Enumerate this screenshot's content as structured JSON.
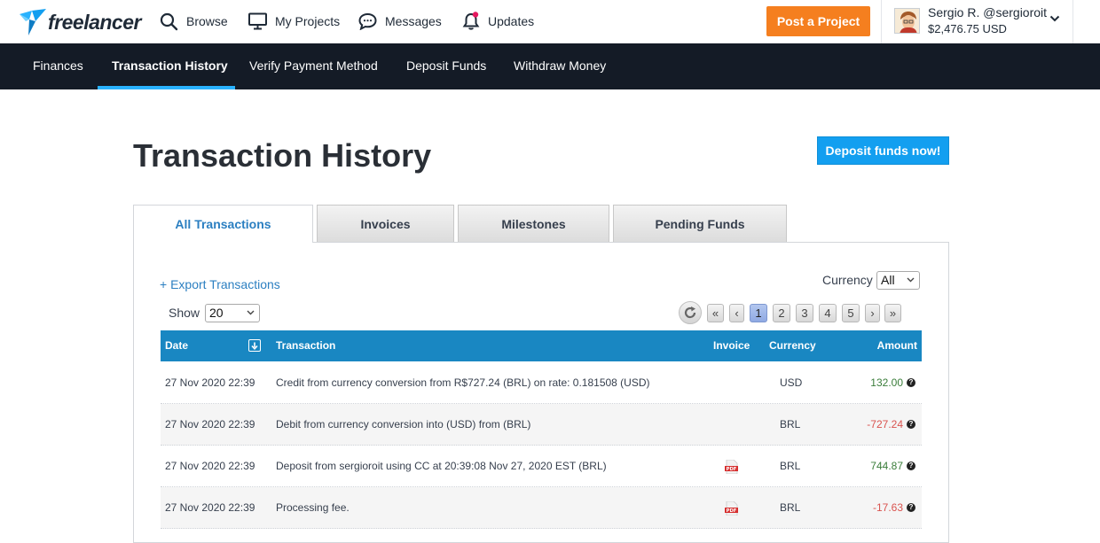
{
  "topbar": {
    "logo_text": "freelancer",
    "nav": [
      {
        "label": "Browse",
        "icon": "search-icon"
      },
      {
        "label": "My Projects",
        "icon": "monitor-icon"
      },
      {
        "label": "Messages",
        "icon": "chat-bubble-icon"
      },
      {
        "label": "Updates",
        "icon": "bell-icon"
      }
    ],
    "post_project_label": "Post a Project",
    "user": {
      "name": "Sergio R. @sergioroit",
      "balance": "$2,476.75 USD"
    }
  },
  "subnav": {
    "items": [
      {
        "label": "Finances"
      },
      {
        "label": "Transaction History"
      },
      {
        "label": "Verify Payment Method"
      },
      {
        "label": "Deposit Funds"
      },
      {
        "label": "Withdraw Money"
      }
    ],
    "active_index": 1
  },
  "page": {
    "title": "Transaction History",
    "deposit_button": "Deposit funds now!"
  },
  "tabs": [
    {
      "label": "All Transactions"
    },
    {
      "label": "Invoices"
    },
    {
      "label": "Milestones"
    },
    {
      "label": "Pending Funds"
    }
  ],
  "controls": {
    "export_link": "+ Export Transactions",
    "currency_label": "Currency",
    "currency_value": "All",
    "show_label": "Show",
    "show_value": "20"
  },
  "pagination": {
    "first": "«",
    "prev": "‹",
    "pages": [
      "1",
      "2",
      "3",
      "4",
      "5"
    ],
    "current": "1",
    "next": "›",
    "last": "»"
  },
  "table": {
    "headers": {
      "date": "Date",
      "transaction": "Transaction",
      "invoice": "Invoice",
      "currency": "Currency",
      "amount": "Amount"
    },
    "rows": [
      {
        "date": "27 Nov 2020 22:39",
        "transaction": "Credit from currency conversion from R$727.24 (BRL) on rate: 0.181508 (USD)",
        "invoice": false,
        "currency": "USD",
        "amount": "132.00",
        "sign": "positive"
      },
      {
        "date": "27 Nov 2020 22:39",
        "transaction": "Debit from currency conversion into (USD) from (BRL)",
        "invoice": false,
        "currency": "BRL",
        "amount": "-727.24",
        "sign": "negative"
      },
      {
        "date": "27 Nov 2020 22:39",
        "transaction": "Deposit from sergioroit using CC at 20:39:08 Nov 27, 2020 EST (BRL)",
        "invoice": true,
        "currency": "BRL",
        "amount": "744.87",
        "sign": "positive"
      },
      {
        "date": "27 Nov 2020 22:39",
        "transaction": "Processing fee.",
        "invoice": true,
        "currency": "BRL",
        "amount": "-17.63",
        "sign": "negative"
      }
    ]
  },
  "colors": {
    "brand_blue": "#139ff0",
    "post_orange": "#f57f1f",
    "table_header": "#1987c2",
    "positive": "#3a7d3a",
    "negative": "#d9534f"
  }
}
